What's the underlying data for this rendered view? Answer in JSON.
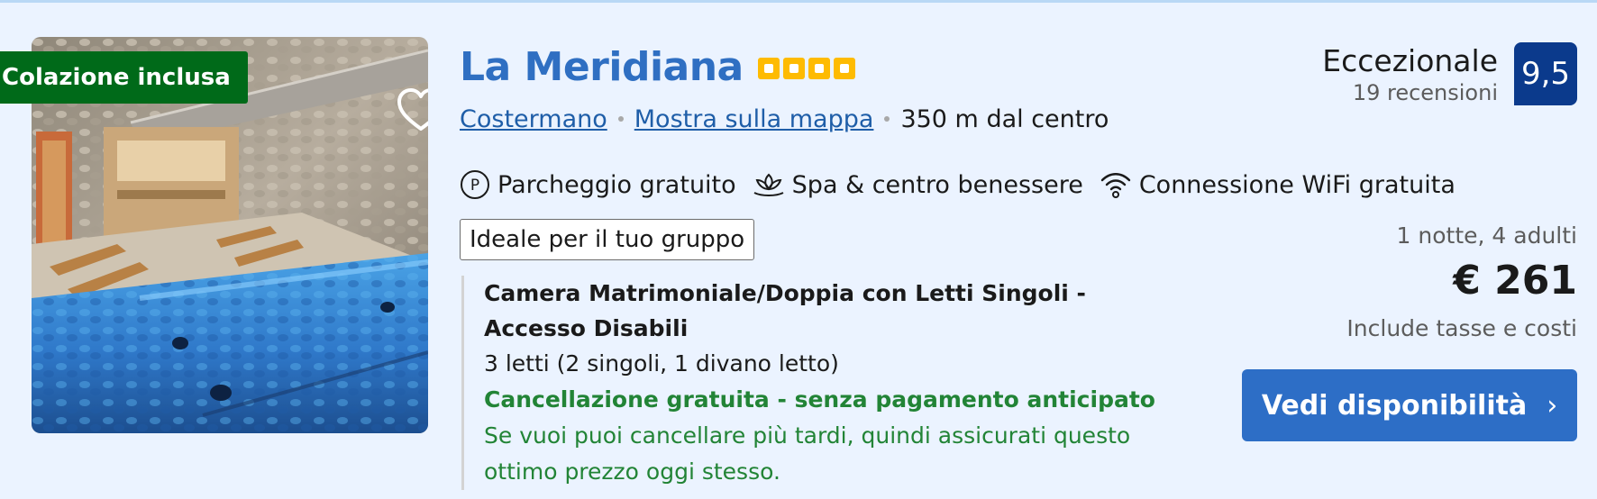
{
  "image": {
    "badge": "Colazione inclusa",
    "favorite_icon": "heart-outline-icon"
  },
  "hotel": {
    "name": "La Meridiana",
    "stars": 4,
    "location": "Costermano",
    "map_link": "Mostra sulla mappa",
    "distance": "350 m dal centro"
  },
  "amenities": [
    {
      "icon": "parking-icon",
      "label": "Parcheggio gratuito"
    },
    {
      "icon": "spa-icon",
      "label": "Spa & centro benessere"
    },
    {
      "icon": "wifi-icon",
      "label": "Connessione WiFi gratuita"
    }
  ],
  "tag": "Ideale per il tuo gruppo",
  "room": {
    "title": "Camera Matrimoniale/Doppia con Letti Singoli - Accesso Disabili",
    "beds": "3 letti (2 singoli, 1 divano letto)",
    "cancellation": "Cancellazione gratuita - senza pagamento anticipato",
    "note": "Se vuoi puoi cancellare più tardi, quindi assicurati questo ottimo prezzo oggi stesso."
  },
  "review": {
    "label": "Eccezionale",
    "count": "19 recensioni",
    "score": "9,5"
  },
  "pricing": {
    "stay": "1 notte, 4 adulti",
    "price": "€ 261",
    "taxes": "Include tasse e costi"
  },
  "cta": {
    "label": "Vedi disponibilità"
  },
  "colors": {
    "accent": "#2d6ec6",
    "score_bg": "#0b3a8c",
    "badge_bg": "#006a19",
    "green_text": "#228436",
    "star": "#febb02"
  }
}
